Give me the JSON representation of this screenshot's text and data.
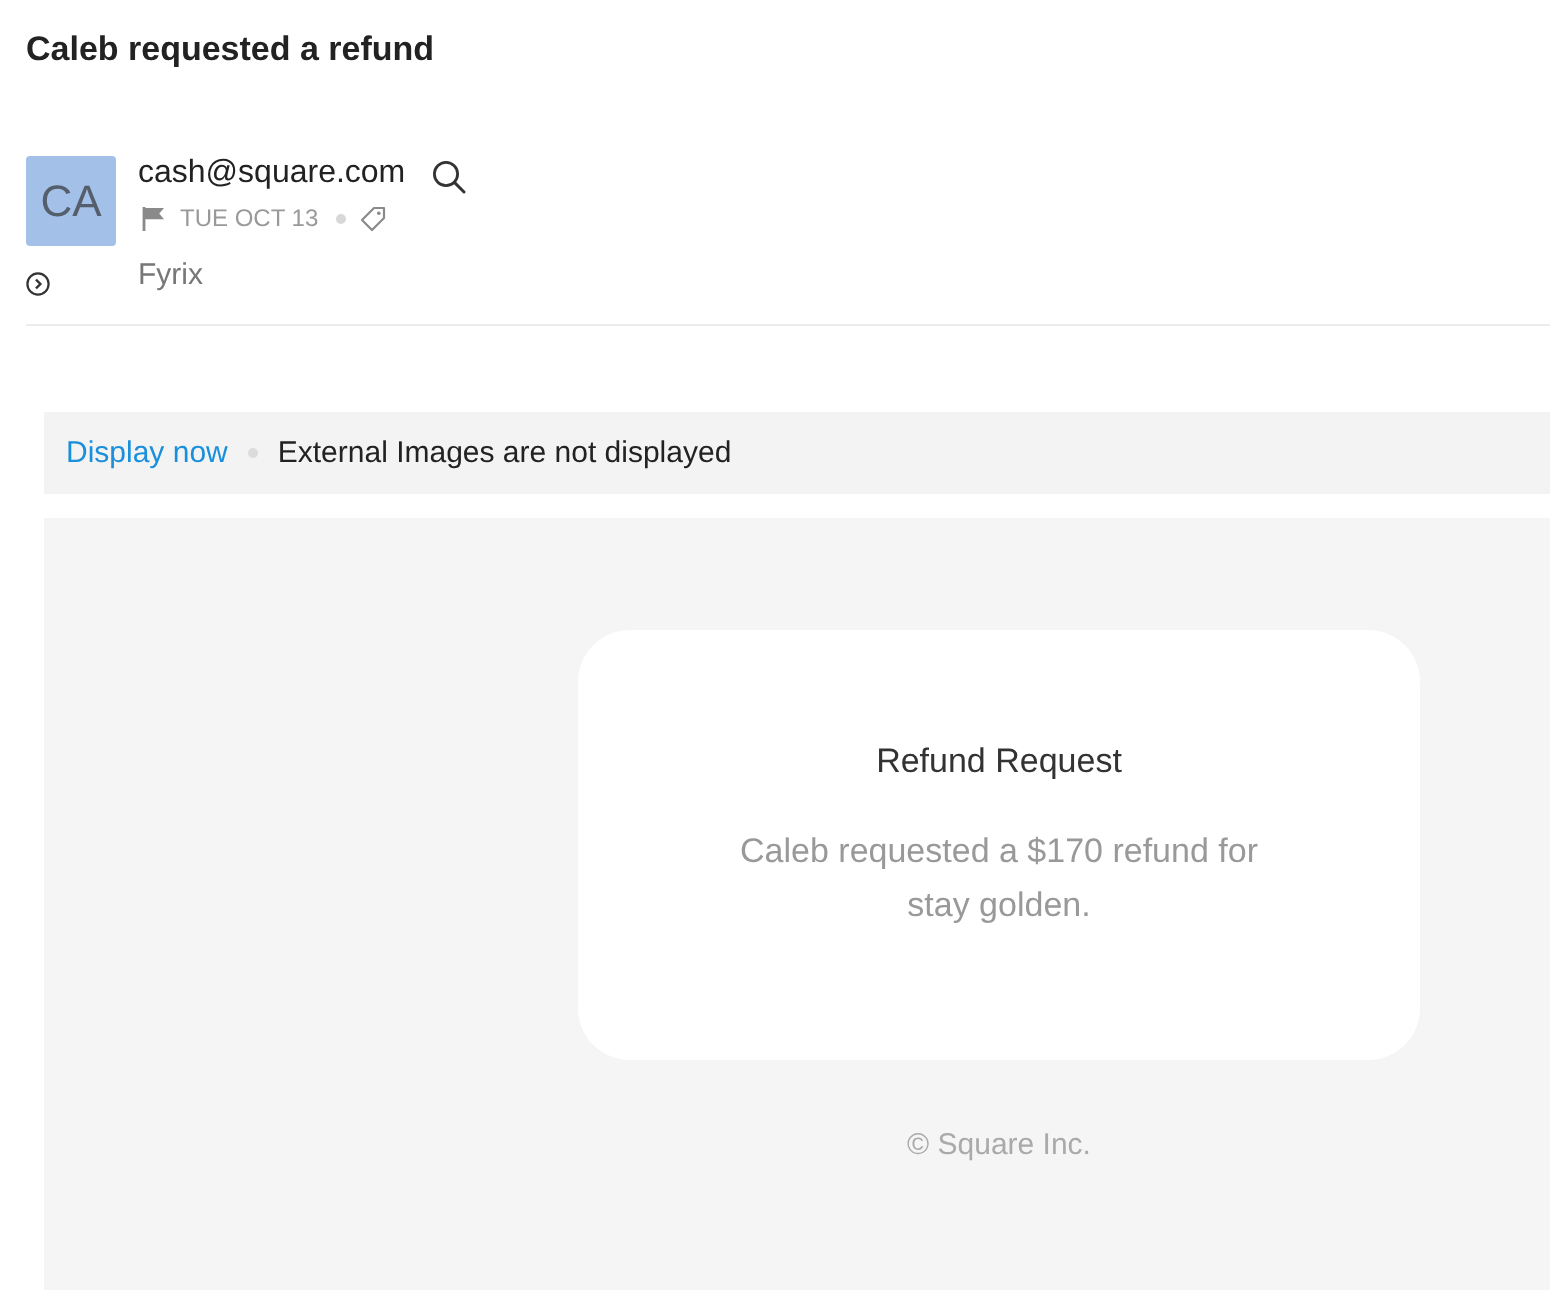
{
  "title": "Caleb requested a refund",
  "sender": {
    "initials": "CA",
    "email": "cash@square.com",
    "date": "TUE OCT 13",
    "folder": "Fyrix"
  },
  "notice": {
    "action": "Display now",
    "message": "External Images are not displayed"
  },
  "email_body": {
    "card": {
      "heading": "Refund Request",
      "text": "Caleb requested a $170 refund for stay golden."
    },
    "footer": "© Square Inc."
  }
}
